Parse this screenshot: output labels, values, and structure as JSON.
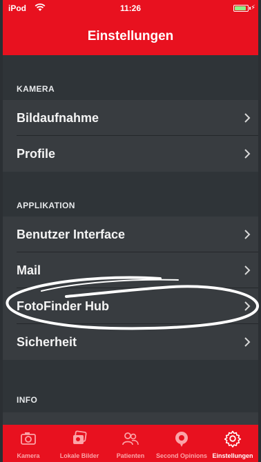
{
  "status_bar": {
    "carrier": "iPod",
    "time": "11:26",
    "battery_color": "#8ef08a"
  },
  "nav": {
    "title": "Einstellungen"
  },
  "sections": {
    "kamera": {
      "header": "KAMERA",
      "items": [
        "Bildaufnahme",
        "Profile"
      ]
    },
    "applikation": {
      "header": "APPLIKATION",
      "items": [
        "Benutzer Interface",
        "Mail",
        "FotoFinder Hub",
        "Sicherheit"
      ]
    },
    "info": {
      "header": "INFO"
    }
  },
  "tabbar": {
    "tabs": [
      {
        "label": "Kamera",
        "icon": "camera-icon",
        "active": false
      },
      {
        "label": "Lokale Bilder",
        "icon": "photo-stack-icon",
        "active": false
      },
      {
        "label": "Patienten",
        "icon": "patients-icon",
        "active": false
      },
      {
        "label": "Second Opinions",
        "icon": "second-opinion-icon",
        "active": false
      },
      {
        "label": "Einstellungen",
        "icon": "gear-icon",
        "active": true
      }
    ]
  },
  "colors": {
    "brand_red": "#e8111f",
    "list_bg": "#2f3438",
    "row_bg": "#383c40"
  }
}
